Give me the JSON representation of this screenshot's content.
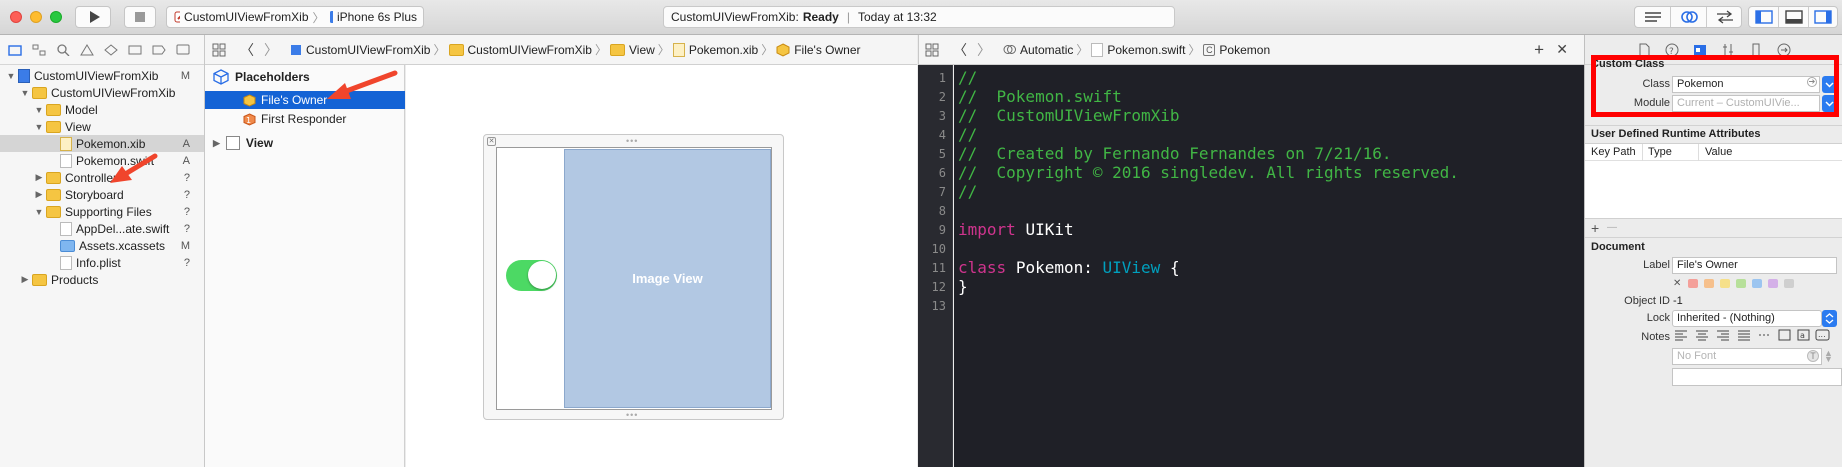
{
  "window": {
    "scheme_target": "CustomUIViewFromXib",
    "device": "iPhone 6s Plus",
    "activity_project": "CustomUIViewFromXib:",
    "activity_status": "Ready",
    "activity_time": "Today at 13:32"
  },
  "navigator": {
    "items": [
      {
        "label": "CustomUIViewFromXib",
        "status": "M",
        "kind": "project"
      },
      {
        "label": "CustomUIViewFromXib",
        "status": "",
        "kind": "folder"
      },
      {
        "label": "Model",
        "status": "",
        "kind": "folder"
      },
      {
        "label": "View",
        "status": "",
        "kind": "folder"
      },
      {
        "label": "Pokemon.xib",
        "status": "A",
        "kind": "xib",
        "selected": true
      },
      {
        "label": "Pokemon.swift",
        "status": "A",
        "kind": "swift"
      },
      {
        "label": "Controller",
        "status": "?",
        "kind": "folder"
      },
      {
        "label": "Storyboard",
        "status": "?",
        "kind": "folder"
      },
      {
        "label": "Supporting Files",
        "status": "?",
        "kind": "folder"
      },
      {
        "label": "AppDel...ate.swift",
        "status": "?",
        "kind": "swift"
      },
      {
        "label": "Assets.xcassets",
        "status": "M",
        "kind": "assets"
      },
      {
        "label": "Info.plist",
        "status": "?",
        "kind": "plist"
      },
      {
        "label": "Products",
        "status": "",
        "kind": "folder"
      }
    ]
  },
  "ib_jumpbar": {
    "crumbs": [
      "CustomUIViewFromXib",
      "CustomUIViewFromXib",
      "View",
      "Pokemon.xib",
      "File's Owner"
    ]
  },
  "outline": {
    "placeholders_label": "Placeholders",
    "files_owner": "File's Owner",
    "first_responder": "First Responder",
    "view_label": "View"
  },
  "canvas": {
    "image_view_label": "Image View",
    "switch_on": true
  },
  "code_jumpbar": {
    "mode": "Automatic",
    "file": "Pokemon.swift",
    "symbol": "Pokemon"
  },
  "code": {
    "line_numbers": [
      "1",
      "2",
      "3",
      "4",
      "5",
      "6",
      "7",
      "8",
      "9",
      "10",
      "11",
      "12",
      "13"
    ],
    "comments": [
      "//",
      "//  Pokemon.swift",
      "//  CustomUIViewFromXib",
      "//",
      "//  Created by Fernando Fernandes on 7/21/16.",
      "//  Copyright © 2016 singledev. All rights reserved.",
      "//"
    ],
    "import_kw": "import",
    "import_mod": "UIKit",
    "class_kw": "class",
    "class_name": "Pokemon:",
    "superclass": "UIView",
    "open_brace": "{",
    "close_brace": "}"
  },
  "inspector": {
    "custom_class_title": "Custom Class",
    "class_label": "Class",
    "class_value": "Pokemon",
    "module_label": "Module",
    "module_placeholder": "Current – CustomUIVie...",
    "runtime_title": "User Defined Runtime Attributes",
    "col_keypath": "Key Path",
    "col_type": "Type",
    "col_value": "Value",
    "add_symbol": "+",
    "remove_symbol": "—",
    "document_title": "Document",
    "doc_label_label": "Label",
    "doc_label_value": "File's Owner",
    "swatch_x": "✕",
    "object_id_label": "Object ID",
    "object_id_value": "-1",
    "lock_label": "Lock",
    "lock_value": "Inherited - (Nothing)",
    "notes_label": "Notes",
    "font_placeholder": "No Font",
    "highlight_color": "#ff0000"
  }
}
